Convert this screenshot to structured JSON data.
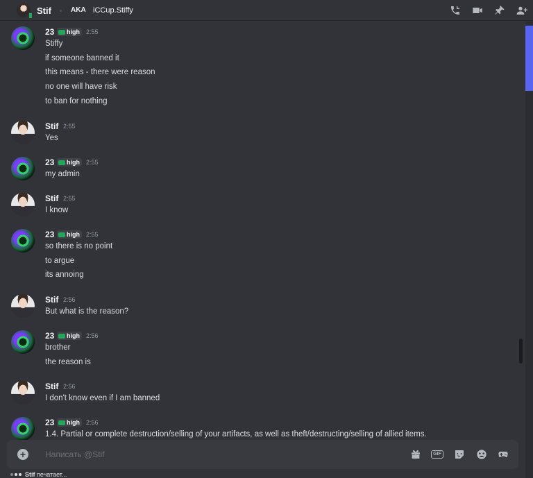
{
  "header": {
    "name": "Stif",
    "aka_label": "AKA",
    "aka_name": "iCCup.Stiffy",
    "icons": [
      "voice-call-icon",
      "video-call-icon",
      "pin-icon",
      "add-member-icon"
    ]
  },
  "badge_label": "high",
  "messages": [
    {
      "author": "23",
      "badge": true,
      "time": "2:55",
      "lines": [
        "Stiffy",
        "if someone banned it",
        "this means - there were reason",
        "no one will have risk",
        "to ban for nothing"
      ]
    },
    {
      "author": "Stif",
      "badge": false,
      "time": "2:55",
      "lines": [
        "Yes"
      ]
    },
    {
      "author": "23",
      "badge": true,
      "time": "2:55",
      "lines": [
        "my admin"
      ]
    },
    {
      "author": "Stif",
      "badge": false,
      "time": "2:55",
      "lines": [
        "I know"
      ]
    },
    {
      "author": "23",
      "badge": true,
      "time": "2:55",
      "lines": [
        "so there is no point",
        "to argue",
        "its annoing"
      ]
    },
    {
      "author": "Stif",
      "badge": false,
      "time": "2:56",
      "lines": [
        "But what is the reason?"
      ]
    },
    {
      "author": "23",
      "badge": true,
      "time": "2:56",
      "lines": [
        "brother",
        "the reason is"
      ]
    },
    {
      "author": "Stif",
      "badge": false,
      "time": "2:56",
      "lines": [
        "I don't know even if I am banned"
      ]
    },
    {
      "author": "23",
      "badge": true,
      "time": "2:56",
      "lines": [
        "1.4. Partial or complete destruction/selling of your artifacts, as well as theft/destructing/selling of allied items."
      ]
    }
  ],
  "composer": {
    "placeholder": "Написать @Stif",
    "icons": [
      "gift-icon",
      "gif-icon",
      "sticker-icon",
      "emoji-icon",
      "activity-icon"
    ],
    "gif_label": "GIF"
  },
  "typing": {
    "user": "Stif",
    "text": " печатает..."
  },
  "colors": {
    "background": "#313338",
    "accent": "#5865f2",
    "online_green": "#23a55a"
  }
}
